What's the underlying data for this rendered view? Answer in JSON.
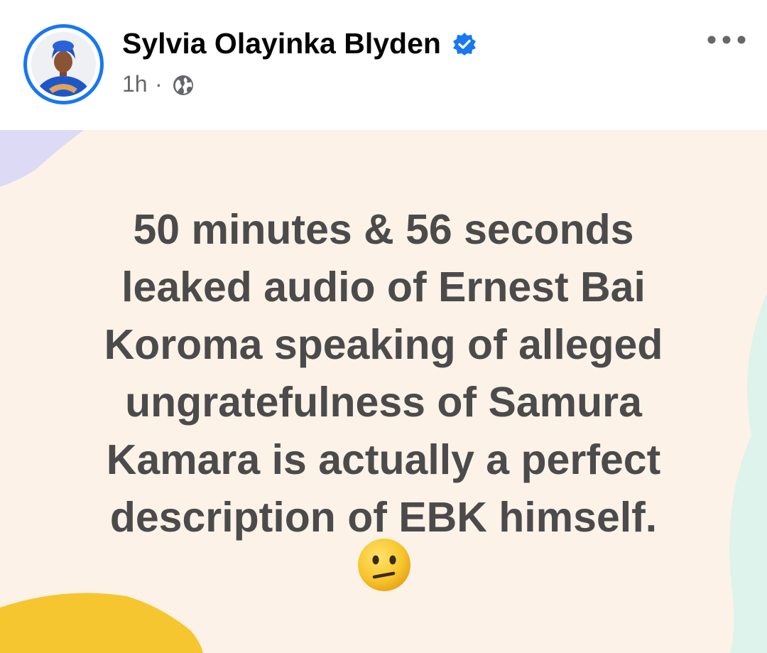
{
  "post": {
    "author": "Sylvia Olayinka Blyden",
    "time": "1h",
    "separator": "·",
    "verified": true,
    "lines": [
      "50 minutes & 56 seconds",
      "leaked audio of Ernest Bai",
      "Koroma speaking of alleged",
      "ungratefulness of Samura",
      "Kamara is actually a perfect",
      "description of EBK himself."
    ],
    "emoji": "neutral-face",
    "background": {
      "base": "#fcf2e8",
      "accent_blue": "#dcdaf5",
      "accent_yellow": "#f5c630",
      "accent_mint": "#ddf3ec"
    }
  },
  "icons": {
    "verified": "verified-badge-icon",
    "audience": "globe-icon",
    "menu": "more-options-icon"
  },
  "colors": {
    "brand": "#1877f2",
    "text_primary": "#050505",
    "text_secondary": "#65676b",
    "post_text": "#4b4b4b"
  }
}
